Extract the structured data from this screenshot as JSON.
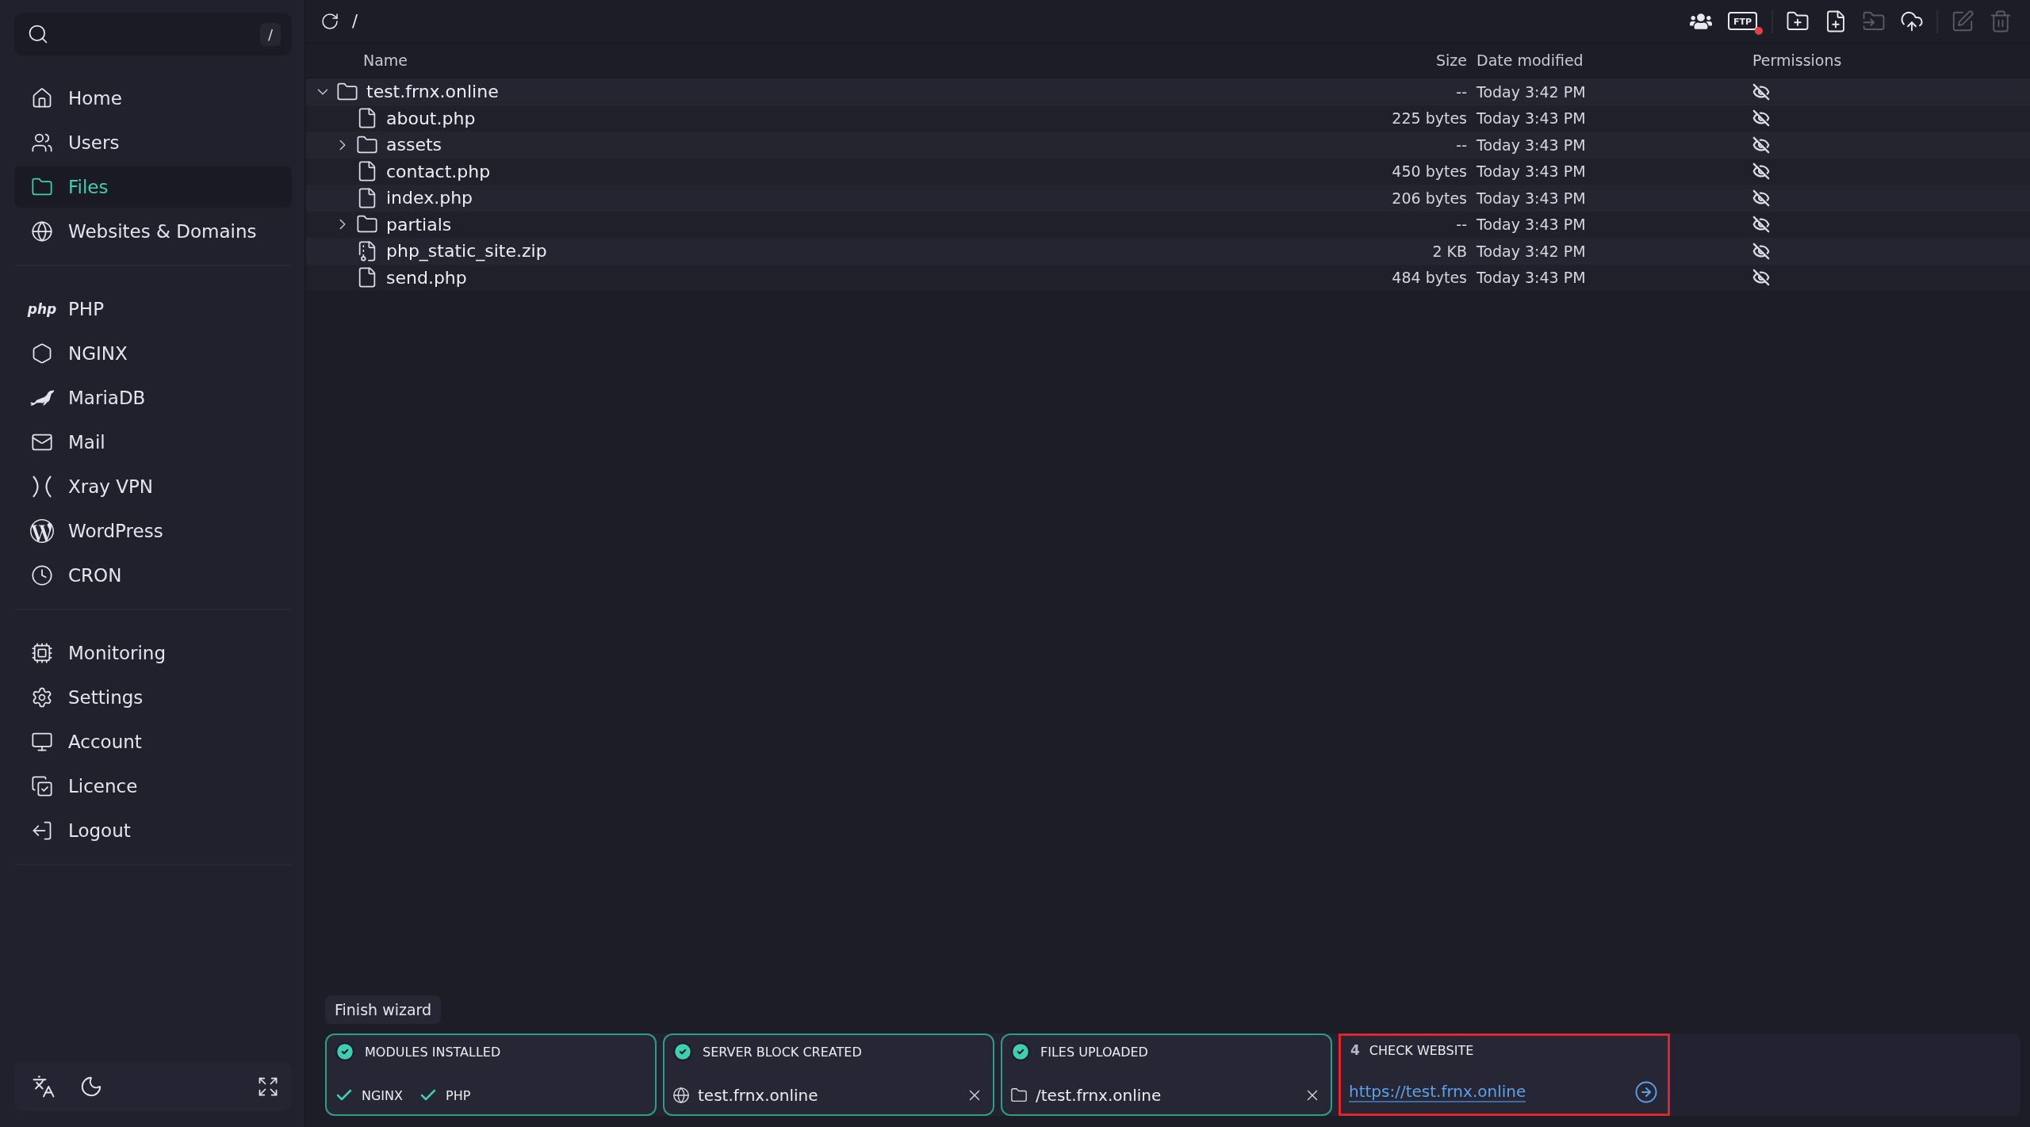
{
  "sidebar": {
    "search": {
      "shortcut": "/"
    },
    "groups": [
      [
        {
          "label": "Home",
          "selected": false
        },
        {
          "label": "Users",
          "selected": false
        },
        {
          "label": "Files",
          "selected": true
        },
        {
          "label": "Websites & Domains",
          "selected": false
        }
      ],
      [
        {
          "label": "PHP",
          "logo_text": "php",
          "selected": false
        },
        {
          "label": "NGINX",
          "selected": false
        },
        {
          "label": "MariaDB",
          "selected": false
        },
        {
          "label": "Mail",
          "selected": false
        },
        {
          "label": "Xray VPN",
          "selected": false
        },
        {
          "label": "WordPress",
          "selected": false
        },
        {
          "label": "CRON",
          "selected": false
        }
      ],
      [
        {
          "label": "Monitoring",
          "selected": false
        },
        {
          "label": "Settings",
          "selected": false
        },
        {
          "label": "Account",
          "selected": false
        },
        {
          "label": "Licence",
          "selected": false
        },
        {
          "label": "Logout",
          "selected": false
        }
      ]
    ]
  },
  "toolbar": {
    "path": "/",
    "actions": [
      {
        "kind": "users",
        "disabled": false
      },
      {
        "kind": "ftp",
        "label": "FTP",
        "disabled": false,
        "notification": true
      },
      {
        "kind": "new-folder",
        "disabled": false
      },
      {
        "kind": "new-file",
        "disabled": false
      },
      {
        "kind": "move",
        "disabled": true
      },
      {
        "kind": "upload",
        "disabled": false
      },
      {
        "kind": "edit",
        "disabled": true
      },
      {
        "kind": "delete",
        "disabled": true
      }
    ]
  },
  "table": {
    "columns": [
      "Name",
      "Size",
      "Date modified",
      "Permissions"
    ],
    "rows": [
      {
        "name": "test.frnx.online",
        "kind": "folder",
        "expanded": true,
        "size": "--",
        "modified": "Today 3:42 PM",
        "children": [
          {
            "name": "about.php",
            "kind": "file",
            "size": "225 bytes",
            "modified": "Today 3:43 PM"
          },
          {
            "name": "assets",
            "kind": "folder",
            "expanded": false,
            "size": "--",
            "modified": "Today 3:43 PM"
          },
          {
            "name": "contact.php",
            "kind": "file",
            "size": "450 bytes",
            "modified": "Today 3:43 PM"
          },
          {
            "name": "index.php",
            "kind": "file",
            "size": "206 bytes",
            "modified": "Today 3:43 PM"
          },
          {
            "name": "partials",
            "kind": "folder",
            "expanded": false,
            "size": "--",
            "modified": "Today 3:43 PM"
          },
          {
            "name": "php_static_site.zip",
            "kind": "zip",
            "size": "2 KB",
            "modified": "Today 3:42 PM"
          },
          {
            "name": "send.php",
            "kind": "file",
            "size": "484 bytes",
            "modified": "Today 3:43 PM"
          }
        ]
      }
    ]
  },
  "wizard": {
    "title": "Finish wizard",
    "steps": [
      {
        "kind": "modules",
        "title": "MODULES INSTALLED",
        "done": true,
        "modules": [
          {
            "label": "NGINX",
            "checked": true
          },
          {
            "label": "PHP",
            "checked": true
          }
        ]
      },
      {
        "kind": "domain",
        "title": "SERVER BLOCK CREATED",
        "done": true,
        "value": "test.frnx.online"
      },
      {
        "kind": "path",
        "title": "FILES UPLOADED",
        "done": true,
        "value": "/test.frnx.online"
      },
      {
        "kind": "link",
        "title": "CHECK WEBSITE",
        "number": "4",
        "done": false,
        "highlighted": true,
        "value": "https://test.frnx.online"
      }
    ]
  }
}
